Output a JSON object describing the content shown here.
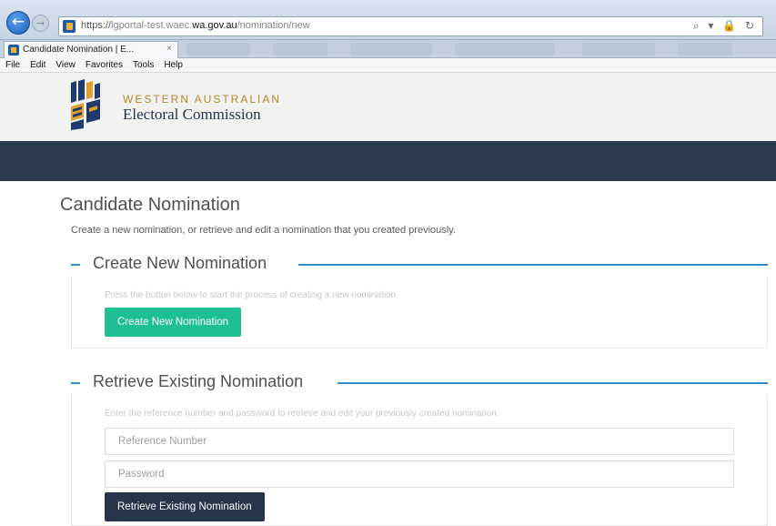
{
  "browser": {
    "url_prefix": "https://",
    "url_host_left": "lgportal-test.waec.",
    "url_host": "wa.gov.au",
    "url_path": "/nomination/new",
    "address_icons": "⌕ ▾ 🔒 ↻",
    "tab_title": "Candidate Nomination | E...",
    "tab_close": "×",
    "menu": [
      "File",
      "Edit",
      "View",
      "Favorites",
      "Tools",
      "Help"
    ]
  },
  "header": {
    "org_line1": "WESTERN AUSTRALIAN",
    "org_line2": "Electoral Commission",
    "logo_icon": "waec-logo-icon",
    "navbar_color": "#2d3b4f"
  },
  "page": {
    "title": "Candidate Nomination",
    "intro": "Create a new nomination, or retrieve and edit a nomination that you created previously."
  },
  "create_section": {
    "title": "Create New Nomination",
    "hint": "Press the button below to start the process of creating a new nomination.",
    "button_label": "Create New Nomination",
    "button_color": "#1fbf94"
  },
  "retrieve_section": {
    "title": "Retrieve Existing Nomination",
    "hint": "Enter the reference number and password to retrieve and edit your previously created nomination.",
    "reference_placeholder": "Reference Number",
    "password_placeholder": "Password",
    "button_label": "Retrieve Existing Nomination",
    "button_color": "#26354a"
  },
  "colors": {
    "accent": "#2a8fc6",
    "heading_text": "#4a5159"
  }
}
